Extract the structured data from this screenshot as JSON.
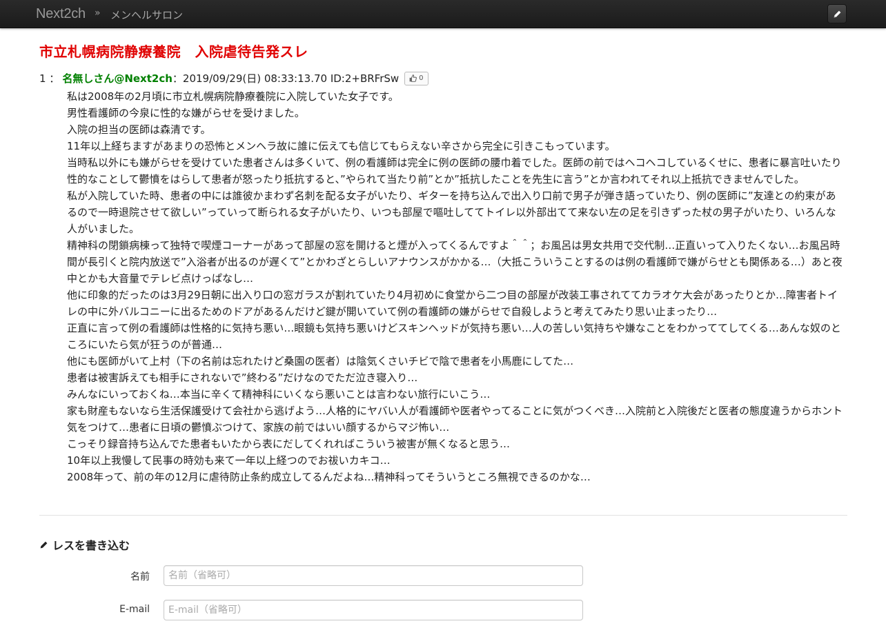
{
  "navbar": {
    "brand": "Next2ch",
    "separator": "»",
    "board": "メンヘルサロン",
    "write_icon": "pencil-icon"
  },
  "thread": {
    "title": "市立札幌病院静療養院　入院虐待告発スレ"
  },
  "post": {
    "number": "1 ：",
    "name": "名無しさん@Next2ch",
    "meta": "：2019/09/29(日) 08:33:13.70 ID:2+BRFrSw",
    "like_icon": "thumbs-up-icon",
    "like_count": "0",
    "lines": [
      "私は2008年の2月頃に市立札幌病院静療養院に入院していた女子です。",
      "男性看護師の今泉に性的な嫌がらせを受けました。",
      "入院の担当の医師は森清です。",
      "11年以上経ちますがあまりの恐怖とメンヘラ故に誰に伝えても信じてもらえない辛さから完全に引きこもっています。",
      "当時私以外にも嫌がらせを受けていた患者さんは多くいて、例の看護師は完全に例の医師の腰巾着でした。医師の前ではヘコヘコしているくせに、患者に暴言吐いたり性的なことして鬱憤をはらして患者が怒ったり抵抗すると、”やられて当たり前”とか”抵抗したことを先生に言う”とか言われてそれ以上抵抗できませんでした。",
      "私が入院していた時、患者の中には誰彼かまわず名刺を配る女子がいたり、ギターを持ち込んで出入り口前で男子が弾き語っていたり、例の医師に”友達との約束があるので一時退院させて欲しい”っていって断られる女子がいたり、いつも部屋で嘔吐しててトイレ以外部出てて来ない左の足を引きずった杖の男子がいたり、いろんな人がいました。",
      "精神科の閉鎖病棟って独特で喫煙コーナーがあって部屋の窓を開けると煙が入ってくるんですよ＾＾；お風呂は男女共用で交代制…正直いって入りたくない…お風呂時間が長引くと院内放送で”入浴者が出るのが遅くて”とかわざとらしいアナウンスがかかる…（大抵こういうことするのは例の看護師で嫌がらせとも関係ある…）あと夜中とかも大音量でテレビ点けっぱなし…",
      "他に印象的だったのは3月29日朝に出入り口の窓ガラスが割れていたり4月初めに食堂から二つ目の部屋が改装工事されててカラオケ大会があったりとか…障害者トイレの中に外バルコニーに出るためのドアがあるんだけど鍵が開いていて例の看護師の嫌がらせで自殺しようと考えてみたり思い止まったり…",
      "正直に言って例の看護師は性格的に気持ち悪い…眼鏡も気持ち悪いけどスキンヘッドが気持ち悪い…人の苦しい気持ちや嫌なことをわかっててしてくる…あんな奴のところにいたら気が狂うのが普通…",
      "他にも医師がいて上村（下の名前は忘れたけど桑園の医者）は陰気くさいチビで陰で患者を小馬鹿にしてた…",
      "患者は被害訴えても相手にされないで”終わる”だけなのでただ泣き寝入り…",
      "みんなにいっておくね…本当に辛くて精神科にいくなら悪いことは言わない旅行にいこう…",
      "家も財産もないなら生活保護受けて会社から逃げよう…人格的にヤバい人が看護師や医者やってることに気がつくべき…入院前と入院後だと医者の態度違うからホント気をつけて…患者に日頃の鬱憤ぶつけて、家族の前ではいい顔するからマジ怖い…",
      "こっそり録音持ち込んでた患者もいたから表にだしてくれればこういう被害が無くなると思う…",
      "10年以上我慢して民事の時効も来て一年以上経つのでお祓いカキコ…",
      "2008年って、前の年の12月に虐待防止条約成立してるんだよね…精神科ってそういうところ無視できるのかな…"
    ]
  },
  "form": {
    "heading_icon": "pencil-icon",
    "heading": "レスを書き込む",
    "name_label": "名前",
    "name_placeholder": "名前（省略可）",
    "name_value": "",
    "email_label": "E-mail",
    "email_placeholder": "E-mail（省略可）",
    "email_value": ""
  }
}
